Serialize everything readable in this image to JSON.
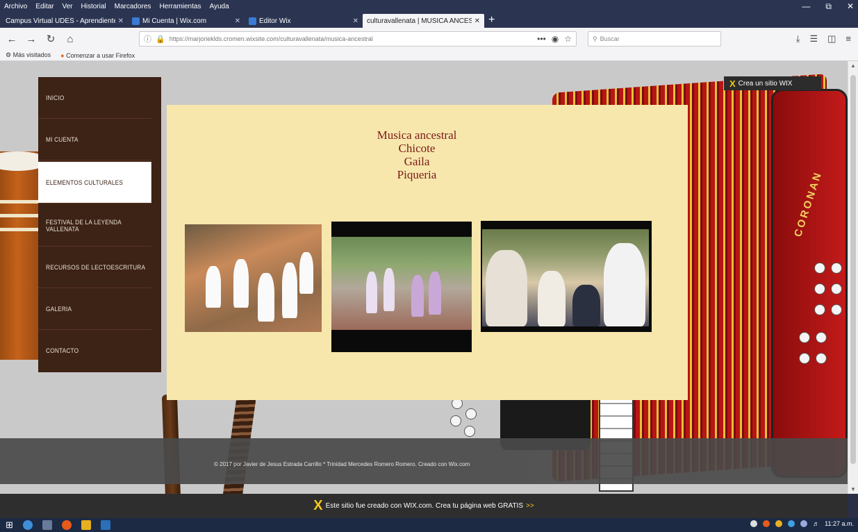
{
  "menubar": {
    "items": [
      "Archivo",
      "Editar",
      "Ver",
      "Historial",
      "Marcadores",
      "Herramientas",
      "Ayuda"
    ]
  },
  "tabs": [
    {
      "label": "Campus Virtual UDES - Aprendiente",
      "active": false
    },
    {
      "label": "Mi Cuenta | Wix.com",
      "active": false
    },
    {
      "label": "Editor Wix",
      "active": false
    },
    {
      "label": "culturavallenata | MUSICA ANCESTR",
      "active": true
    }
  ],
  "nav": {
    "url": "https://marjorieklds.cromen.wixsite.com/culturavallenata/musica-ancestral",
    "search_placeholder": "Buscar",
    "more": "•••"
  },
  "bookmarks": [
    "Más visitados",
    "Comenzar a usar Firefox"
  ],
  "wix_badge": "Crea un sitio WIX",
  "site_menu": [
    {
      "label": "INICIO",
      "active": false
    },
    {
      "label": "MI CUENTA",
      "active": false
    },
    {
      "label": "ELEMENTOS CULTURALES",
      "active": true
    },
    {
      "label": "FESTIVAL DE LA LEYENDA VALLENATA",
      "active": false
    },
    {
      "label": "RECURSOS DE LECTOESCRITURA",
      "active": false
    },
    {
      "label": "GALERIA",
      "active": false
    },
    {
      "label": "CONTACTO",
      "active": false
    }
  ],
  "content": {
    "lines": [
      "Musica ancestral",
      "Chicote",
      "Gaila",
      "Piqueria"
    ]
  },
  "accordion_brand": "CORONAN",
  "footer": "© 2017 por Javier de Jesus Estrada Carrillo * Trinidad Mercedes Romero Romero. Creado con Wix.com",
  "wix_banner": {
    "text": "Este sitio fue creado con WIX.com. Crea tu página web GRATIS",
    "arrows": ">>"
  },
  "taskbar": {
    "clock": "11:27 a.m."
  },
  "colors": {
    "menu_bg": "#3d2216",
    "content_bg": "#f7e7ac",
    "heading": "#7a1a1a",
    "wix_yellow": "#f6c71a"
  }
}
